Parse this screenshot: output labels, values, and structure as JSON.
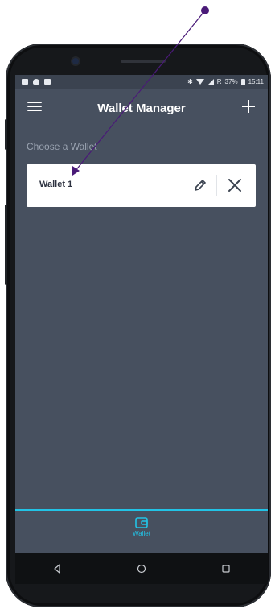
{
  "status_bar": {
    "battery_text": "37%",
    "time": "15:11"
  },
  "app_bar": {
    "title": "Wallet Manager"
  },
  "content": {
    "section_label": "Choose a Wallet",
    "wallets": [
      {
        "name": "Wallet 1"
      }
    ]
  },
  "bottom_nav": {
    "items": [
      {
        "label": "Wallet",
        "icon": "wallet-icon",
        "active": true
      }
    ]
  },
  "system_nav": {
    "icons": [
      "back-icon",
      "home-icon",
      "recents-icon"
    ]
  },
  "colors": {
    "accent": "#22c3e6",
    "screen_bg": "#47505f",
    "card_bg": "#ffffff",
    "annotation": "#4a1a78"
  }
}
